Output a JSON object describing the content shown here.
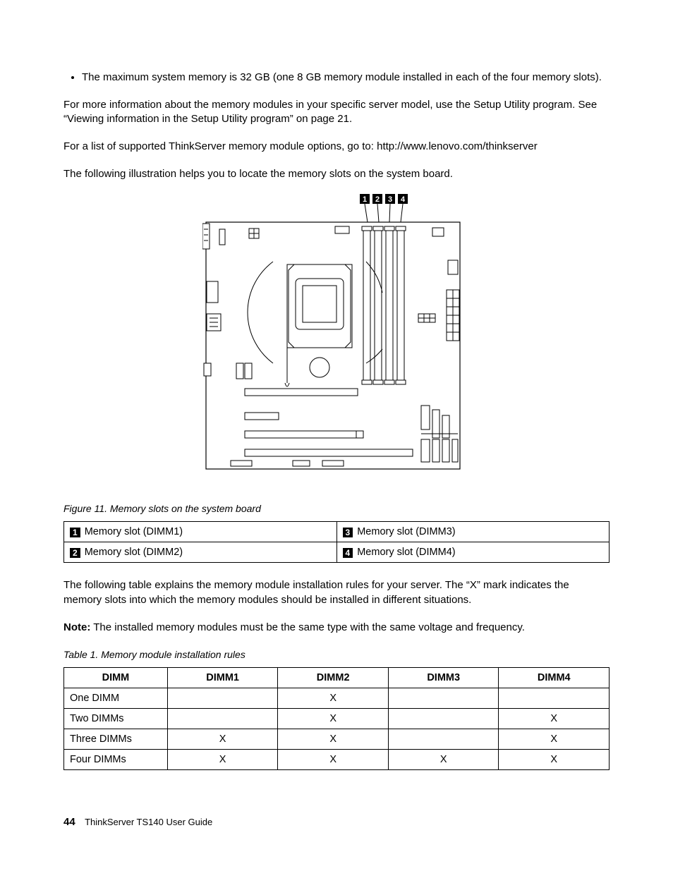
{
  "bullet": "The maximum system memory is 32 GB (one 8 GB memory module installed in each of the four memory slots).",
  "para_moreinfo": "For more information about the memory modules in your specific server model, use the Setup Utility program. See “Viewing information in the Setup Utility program” on page 21.",
  "para_list_prefix": "For a list of supported ThinkServer memory module options, go to: ",
  "url_text": "http://www.lenovo.com/thinkserver",
  "para_illustration": "The following illustration helps you to locate the memory slots on the system board.",
  "figure_caption": "Figure 11.  Memory slots on the system board",
  "callouts": {
    "c1_num": "1",
    "c1_label": "Memory slot (DIMM1)",
    "c2_num": "2",
    "c2_label": "Memory slot (DIMM2)",
    "c3_num": "3",
    "c3_label": "Memory slot (DIMM3)",
    "c4_num": "4",
    "c4_label": "Memory slot (DIMM4)"
  },
  "para_table_intro": "The following table explains the memory module installation rules for your server. The “X” mark indicates the memory slots into which the memory modules should be installed in different situations.",
  "note_label": "Note:",
  "note_text": " The installed memory modules must be the same type with the same voltage and frequency.",
  "table_caption": "Table 1.  Memory module installation rules",
  "rules_headers": {
    "h0": "DIMM",
    "h1": "DIMM1",
    "h2": "DIMM2",
    "h3": "DIMM3",
    "h4": "DIMM4"
  },
  "rules_rows": [
    {
      "label": "One DIMM",
      "d1": "",
      "d2": "X",
      "d3": "",
      "d4": ""
    },
    {
      "label": "Two DIMMs",
      "d1": "",
      "d2": "X",
      "d3": "",
      "d4": "X"
    },
    {
      "label": "Three DIMMs",
      "d1": "X",
      "d2": "X",
      "d3": "",
      "d4": "X"
    },
    {
      "label": "Four DIMMs",
      "d1": "X",
      "d2": "X",
      "d3": "X",
      "d4": "X"
    }
  ],
  "footer": {
    "page_number": "44",
    "footer_text": "ThinkServer TS140 User Guide"
  },
  "diagram_labels": {
    "n1": "1",
    "n2": "2",
    "n3": "3",
    "n4": "4"
  }
}
